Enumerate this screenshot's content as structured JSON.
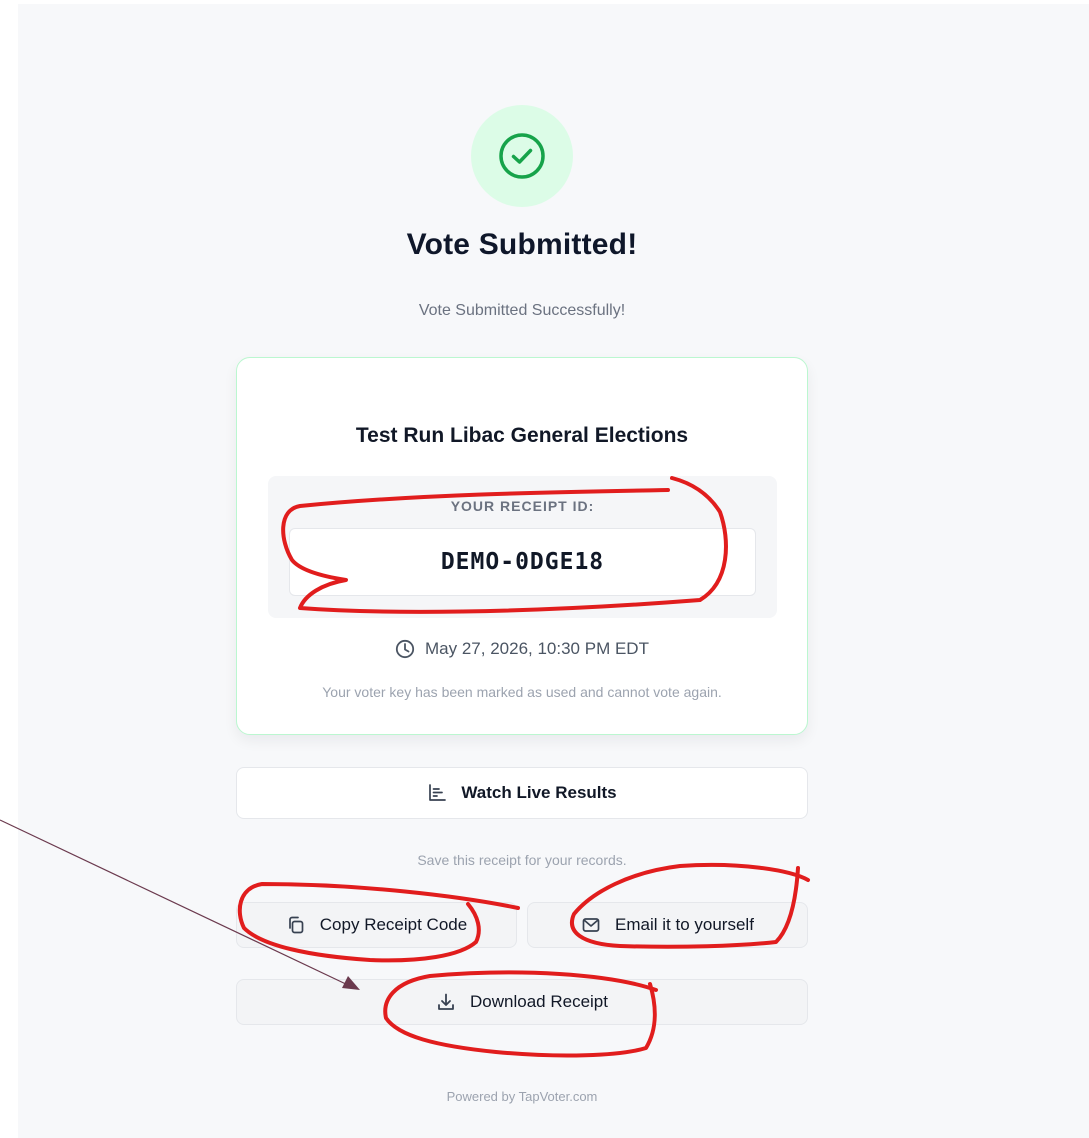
{
  "status": {
    "title": "Vote Submitted!",
    "subtitle": "Vote Submitted Successfully!"
  },
  "receipt": {
    "election_name": "Test Run Libac General Elections",
    "label": "YOUR RECEIPT ID:",
    "id": "DEMO-0DGE18",
    "timestamp": "May 27, 2026, 10:30 PM EDT",
    "voter_note": "Your voter key has been marked as used and cannot vote again."
  },
  "actions": {
    "live_results_label": "Watch Live Results",
    "save_note": "Save this receipt for your records.",
    "copy_label": "Copy Receipt Code",
    "email_label": "Email it to yourself",
    "download_label": "Download Receipt"
  },
  "footer": {
    "powered_by": "Powered by TapVoter.com"
  },
  "icons": {
    "success": "check-circle-icon",
    "clock": "clock-icon",
    "chart": "bar-chart-icon",
    "copy": "copy-icon",
    "email": "mail-icon",
    "download": "download-icon"
  },
  "colors": {
    "success_green": "#16a34a",
    "success_bg": "#dcfce7",
    "annotation_red": "#e11d1d",
    "arrow_color": "#6b3a4e"
  }
}
